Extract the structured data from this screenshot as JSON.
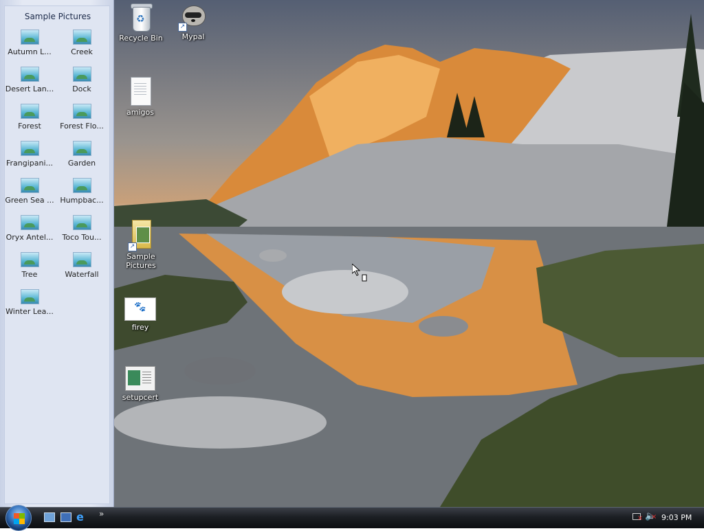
{
  "sidebar": {
    "title": "Sample Pictures",
    "pictures": [
      {
        "label": "Autumn L..."
      },
      {
        "label": "Creek"
      },
      {
        "label": "Desert Lan..."
      },
      {
        "label": "Dock"
      },
      {
        "label": "Forest"
      },
      {
        "label": "Forest Flo..."
      },
      {
        "label": "Frangipani..."
      },
      {
        "label": "Garden"
      },
      {
        "label": "Green Sea ..."
      },
      {
        "label": "Humpbac..."
      },
      {
        "label": "Oryx Antel..."
      },
      {
        "label": "Toco Tou..."
      },
      {
        "label": "Tree"
      },
      {
        "label": "Waterfall"
      },
      {
        "label": "Winter Lea..."
      }
    ]
  },
  "desktop": {
    "icons": {
      "recycle_bin": "Recycle Bin",
      "mypal": "Mypal",
      "amigos": "amigos",
      "sample_pictures": "Sample Pictures",
      "firey": "firey",
      "setupcert": "setupcert"
    }
  },
  "taskbar": {
    "clock": "9:03 PM",
    "more_glyph": "»"
  },
  "colors": {
    "taskbar": "#1c1f24",
    "sidebar": "#dfe5f2",
    "start_orb": "#3b78c2"
  }
}
